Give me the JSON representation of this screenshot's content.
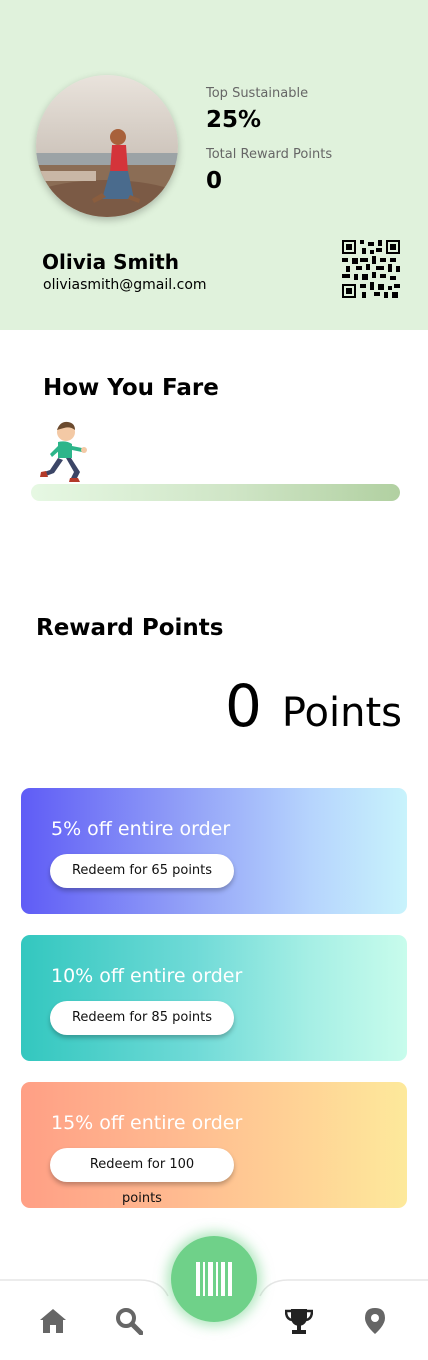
{
  "profile": {
    "name": "Olivia Smith",
    "email": "oliviasmith@gmail.com",
    "avatar_alt": "profile photo"
  },
  "stats": {
    "top_sustainable_label": "Top Sustainable",
    "top_sustainable_value": "25%",
    "reward_points_label": "Total Reward Points",
    "reward_points_value": "0"
  },
  "progress": {
    "title": "How You Fare",
    "fraction": 0
  },
  "rewards": {
    "title": "Reward Points",
    "points_value": "0",
    "points_unit": "Points"
  },
  "offers": [
    {
      "title": "5% off entire order",
      "button": "Redeem for 65 points"
    },
    {
      "title": "10% off entire order",
      "button": "Redeem for 85 points"
    },
    {
      "title": "15% off entire order",
      "button": "Redeem for 100 points"
    }
  ],
  "nav": {
    "items": [
      "home-icon",
      "search-icon",
      "barcode-icon",
      "trophy-icon",
      "location-pin-icon"
    ]
  },
  "colors": {
    "header_bg": "#e0f2dc",
    "scan_button": "#6fd189",
    "nav_icon": "#666666",
    "nav_icon_active": "#222222"
  }
}
